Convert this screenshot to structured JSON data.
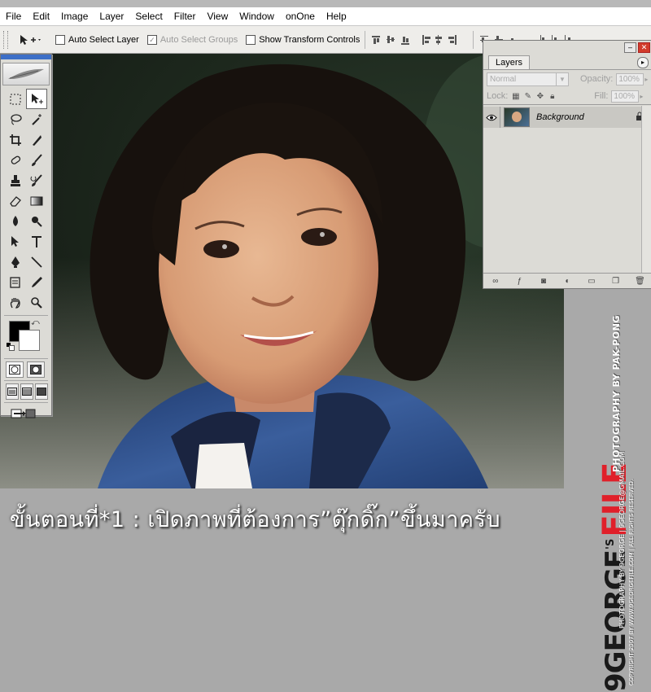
{
  "menu": [
    "File",
    "Edit",
    "Image",
    "Layer",
    "Select",
    "Filter",
    "View",
    "Window",
    "onOne",
    "Help"
  ],
  "options": {
    "auto_select_layer": "Auto Select Layer",
    "auto_select_groups": "Auto Select Groups",
    "show_transform_controls": "Show Transform Controls"
  },
  "layers_panel": {
    "tab": "Layers",
    "blend_mode": "Normal",
    "opacity_label": "Opacity:",
    "opacity_value": "100%",
    "lock_label": "Lock:",
    "fill_label": "Fill:",
    "fill_value": "100%",
    "layer_name": "Background"
  },
  "caption": "ขั้นตอนที่*1 : เปิดภาพที่ต้องการ”ดุ๊กดิ๊ก”ขึ้นมาครับ",
  "watermark": {
    "logo_left": "9GEORGE",
    "logo_s": "'S",
    "logo_right": "FILE",
    "line1": "PHOTOGRAPHY BY PAK-PONG",
    "line2": "PHOTOGRAPHY BY 9GEORGE | 9GEORGE@GMAIL.COM",
    "line3": "COPYRIGHT 2007 BY WWW.9GEORGEFILE.COM | ALL RIGHTS RESERVED."
  },
  "colors": {
    "foreground": "#000000",
    "background": "#ffffff",
    "watermark_accent": "#e0202a"
  }
}
